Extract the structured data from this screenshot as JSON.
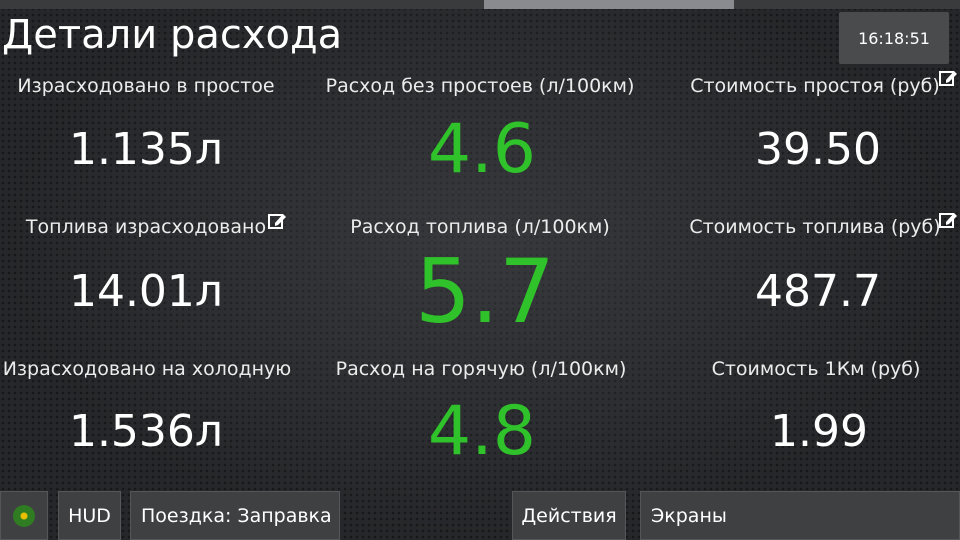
{
  "header": {
    "title": "Детали расхода",
    "clock": "16:18:51"
  },
  "metrics": {
    "idle_consumed": {
      "label": "Израсходовано в простое",
      "value": "1.135л"
    },
    "no_idle_rate": {
      "label": "Расход без простоев (л/100км)",
      "value": "4.6"
    },
    "idle_cost": {
      "label": "Стоимость простоя (руб)",
      "value": "39.50"
    },
    "fuel_consumed": {
      "label": "Топлива израсходовано",
      "value": "14.01л"
    },
    "fuel_rate": {
      "label": "Расход топлива (л/100км)",
      "value": "5.7"
    },
    "fuel_cost": {
      "label": "Стоимость топлива (руб)",
      "value": "487.7"
    },
    "cold_consumed": {
      "label": "Израсходовано на холодную",
      "value": "1.536л"
    },
    "hot_rate": {
      "label": "Расход на горячую (л/100км)",
      "value": "4.8"
    },
    "km_cost": {
      "label": "Стоимость 1Км (руб)",
      "value": "1.99"
    }
  },
  "bottom_bar": {
    "hud": "HUD",
    "trip": "Поездка: Заправка",
    "actions": "Действия",
    "screens": "Экраны"
  },
  "icons": {
    "edit": "edit-icon",
    "status": "status-indicator-icon"
  },
  "colors": {
    "accent_green": "#2fc22a",
    "text": "#ffffff",
    "button_bg": "#3f4042"
  }
}
